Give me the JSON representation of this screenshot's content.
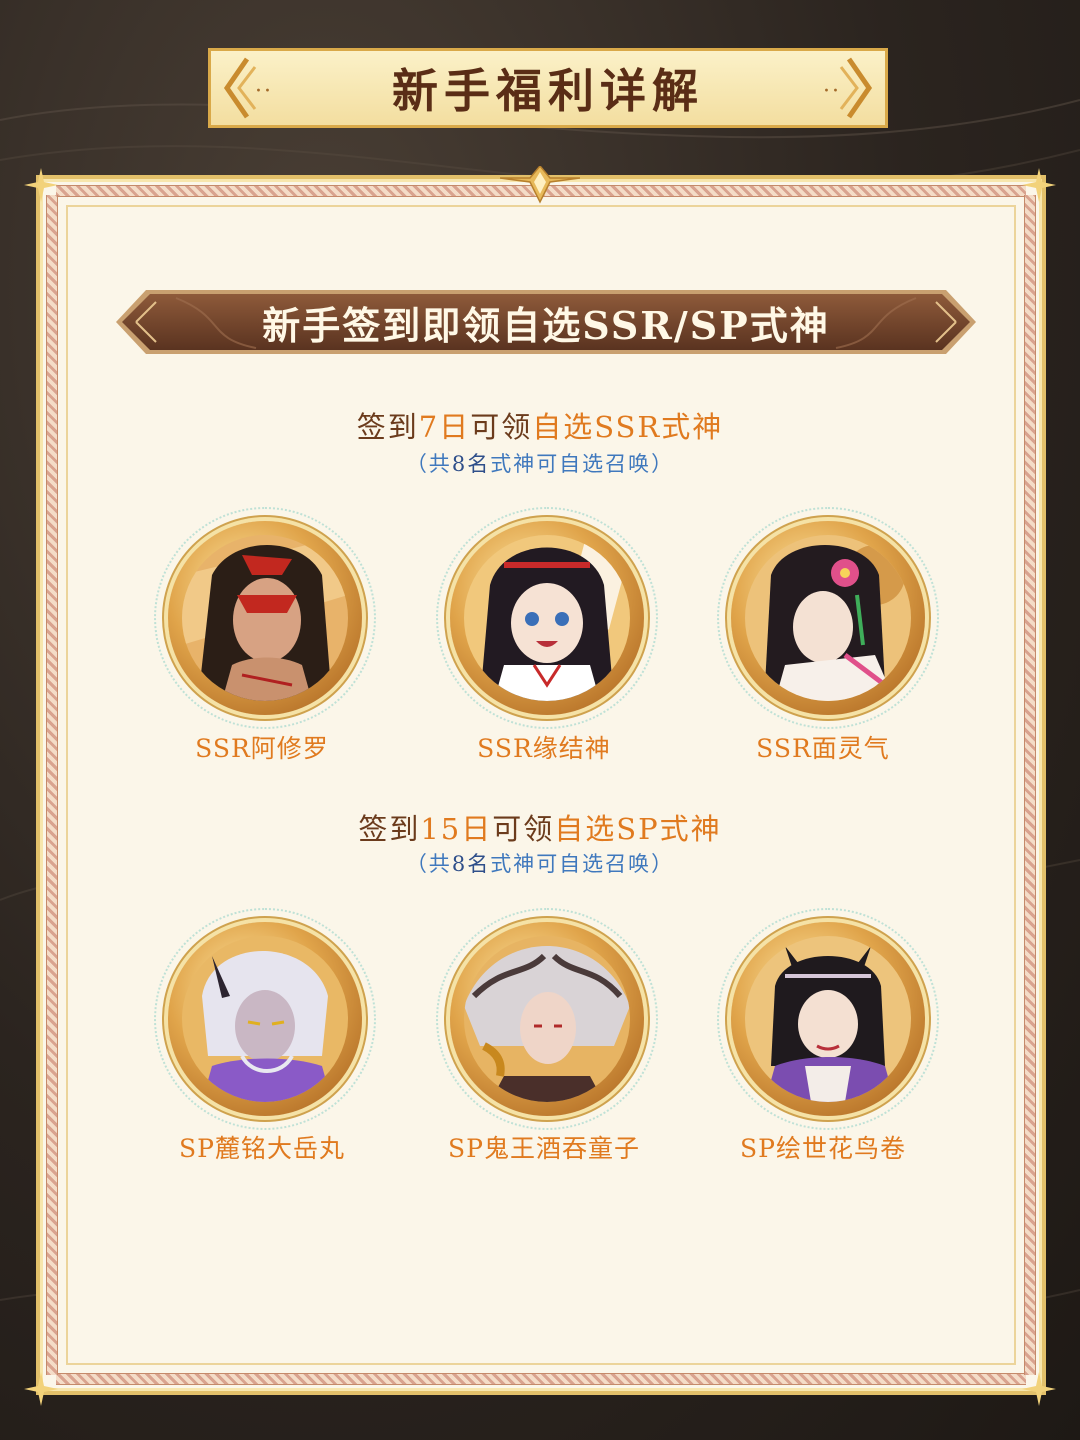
{
  "header": {
    "title": "新手福利详解",
    "dots": "··"
  },
  "banner": {
    "text": "新手签到即领自选SSR/SP式神"
  },
  "sections": [
    {
      "heading_parts": [
        "签到",
        "7日",
        "可领",
        "自选SSR式神"
      ],
      "note_parts": [
        "（共",
        "8",
        "名",
        "式神",
        "可自选召唤）"
      ],
      "characters": [
        {
          "name": "SSR阿修罗",
          "icon": "asura-portrait-icon",
          "hair": "#2b1e16",
          "accent": "#c2281f",
          "skin": "#d7a283"
        },
        {
          "name": "SSR缘结神",
          "icon": "enmusubi-portrait-icon",
          "hair": "#221a22",
          "accent": "#c82a2a",
          "skin": "#f6e2d4"
        },
        {
          "name": "SSR面灵气",
          "icon": "menreiki-portrait-icon",
          "hair": "#231b1f",
          "accent": "#e0508a",
          "skin": "#f4e1d3"
        }
      ]
    },
    {
      "heading_parts": [
        "签到",
        "15日",
        "可领",
        "自选SP式神"
      ],
      "note_parts": [
        "（共",
        "8",
        "名",
        "式神",
        "可自选召唤）"
      ],
      "characters": [
        {
          "name": "SP麓铭大岳丸",
          "icon": "ootakemaru-portrait-icon",
          "hair": "#e6e4ee",
          "accent": "#8a5ac7",
          "skin": "#c9b7c4"
        },
        {
          "name": "SP鬼王酒吞童子",
          "icon": "shuten-doji-portrait-icon",
          "hair": "#d9d3d6",
          "accent": "#4a2f2a",
          "skin": "#efd5c8"
        },
        {
          "name": "SP绘世花鸟卷",
          "icon": "kacho-fugetsu-portrait-icon",
          "hair": "#1f1a1e",
          "accent": "#7b4db0",
          "skin": "#f4e0d2"
        }
      ]
    }
  ],
  "colors": {
    "accent_orange": "#e07a1f",
    "heading_brown": "#6b3b1c",
    "note_blue": "#3f78bd",
    "card_bg": "#fbf6e9",
    "gold": "#d9a949"
  }
}
